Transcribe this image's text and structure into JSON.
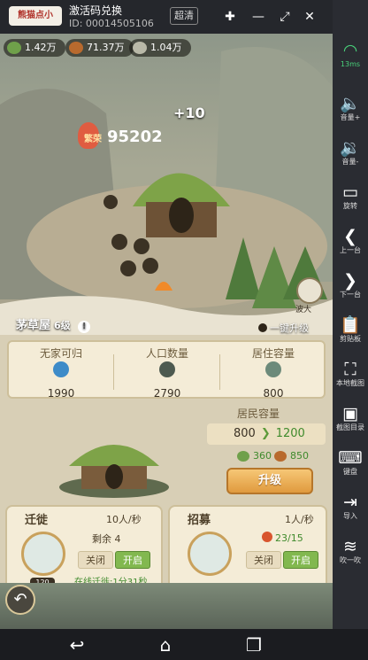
{
  "app": {
    "badge": "熊猫点小",
    "title": "激活码兑换",
    "id_text": "ID: 00014505106",
    "hd_label": "超清"
  },
  "resources": [
    {
      "icon": "leaf-icon",
      "value": "1.42万",
      "color": "#6fa04a"
    },
    {
      "icon": "wood-icon",
      "value": "71.37万",
      "color": "#b86a2e"
    },
    {
      "icon": "stone-icon",
      "value": "1.04万",
      "color": "#b9b9a8"
    }
  ],
  "scene": {
    "prosperity_label": "繁荣",
    "prosperity_value": "95202",
    "floating_number": "+10",
    "building_name": "茅草屋",
    "building_level": "6级",
    "upgrade_all_label": "一键升级",
    "npc_label": "波大"
  },
  "stats": {
    "columns": [
      {
        "head": "无家可归",
        "value": "1990",
        "icon": "homeless-icon",
        "color": "#3d8bc8"
      },
      {
        "head": "人口数量",
        "value": "2790",
        "icon": "population-icon",
        "color": "#4d5a50"
      },
      {
        "head": "居住容量",
        "value": "800",
        "icon": "house-icon",
        "color": "#6c8a7a"
      }
    ]
  },
  "capacity": {
    "title": "居民容量",
    "current": "800",
    "next": "1200",
    "cost_leaf": "360",
    "cost_wood": "850",
    "upgrade_label": "升级"
  },
  "migrate": {
    "title": "迁徙",
    "rate": "10人/秒",
    "remain_label": "剩余",
    "remain_value": "4",
    "level": "120",
    "off_label": "关闭",
    "on_label": "开启",
    "online_text": "在线迁徙:1分31秒"
  },
  "recruit": {
    "title": "招募",
    "rate": "1人/秒",
    "progress_text": "23/15",
    "off_label": "关闭",
    "on_label": "开启"
  },
  "sidebar": {
    "items": [
      {
        "icon": "wifi-icon",
        "label": "13ms"
      },
      {
        "icon": "volume-up-icon",
        "label": "音量+"
      },
      {
        "icon": "volume-down-icon",
        "label": "音量-"
      },
      {
        "icon": "rotate-icon",
        "label": "旋转"
      },
      {
        "icon": "previous-icon",
        "label": "上一台"
      },
      {
        "icon": "next-icon",
        "label": "下一台"
      },
      {
        "icon": "clipboard-icon",
        "label": "剪贴板"
      },
      {
        "icon": "crop-icon",
        "label": "本地截图"
      },
      {
        "icon": "screenshot-folder-icon",
        "label": "截图目录"
      },
      {
        "icon": "keyboard-icon",
        "label": "键盘"
      },
      {
        "icon": "import-icon",
        "label": "导入"
      },
      {
        "icon": "shake-icon",
        "label": "吹一吹"
      }
    ]
  }
}
